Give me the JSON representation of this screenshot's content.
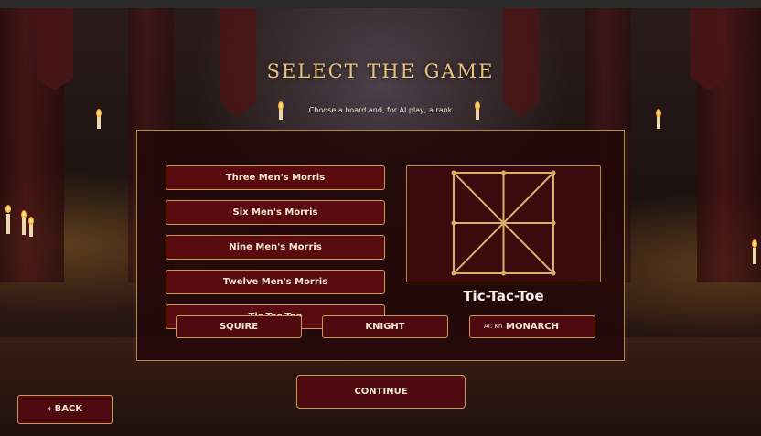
{
  "header": {
    "title": "SELECT THE GAME",
    "subtitle": "Choose a board and, for AI play, a rank"
  },
  "games": [
    {
      "label": "Three Men's Morris"
    },
    {
      "label": "Six Men's Morris"
    },
    {
      "label": "Nine Men's Morris"
    },
    {
      "label": "Twelve Men's Morris"
    },
    {
      "label": "Tic-Tac-Toe"
    }
  ],
  "preview": {
    "game_name": "Tic-Tac-Toe",
    "line_color": "#d9b06a"
  },
  "ranks": [
    {
      "label": "SQUIRE"
    },
    {
      "label": "KNIGHT"
    },
    {
      "label": "MONARCH"
    }
  ],
  "ai_label": "AI: Kn",
  "continue_label": "CONTINUE",
  "back_label": "‹ BACK"
}
